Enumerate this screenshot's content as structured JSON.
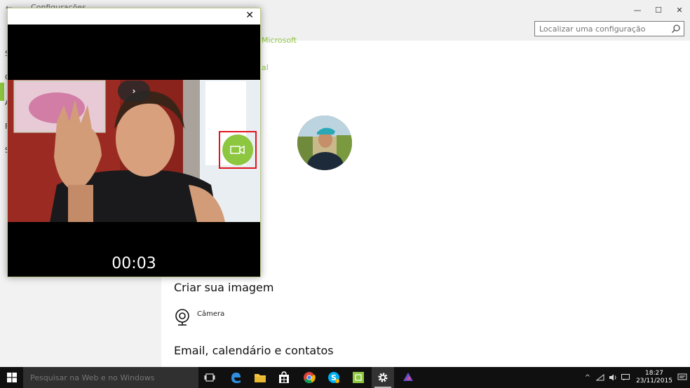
{
  "settings": {
    "title": "Configurações",
    "back_glyph": "←",
    "controls": {
      "minimize": "—",
      "maximize": "☐",
      "close": "✕"
    },
    "search_placeholder": "Localizar uma configuração",
    "sidebar_letters": [
      "S",
      "C",
      "A",
      "F",
      "S"
    ],
    "account_link_1": "Microsoft",
    "account_link_2": "al",
    "section_create_image": "Criar sua imagem",
    "camera_label": "Câmera",
    "section_email": "Email, calendário e contatos"
  },
  "camera_app": {
    "close_glyph": "✕",
    "nav_toggle_glyph": "›",
    "timer": "00:03",
    "record_icon": "video-camera-icon"
  },
  "taskbar": {
    "search_placeholder": "Pesquisar na Web e no Windows",
    "apps": [
      "task-view-icon",
      "edge-icon",
      "file-explorer-icon",
      "store-icon",
      "chrome-icon",
      "skype-icon",
      "green-app-icon",
      "settings-gear-icon",
      "media-app-icon"
    ],
    "tray_chevron": "^",
    "time": "18:27",
    "date": "23/11/2015"
  },
  "colors": {
    "accent": "#8dc63f",
    "highlight": "#e3141c",
    "taskbar": "#101010"
  }
}
